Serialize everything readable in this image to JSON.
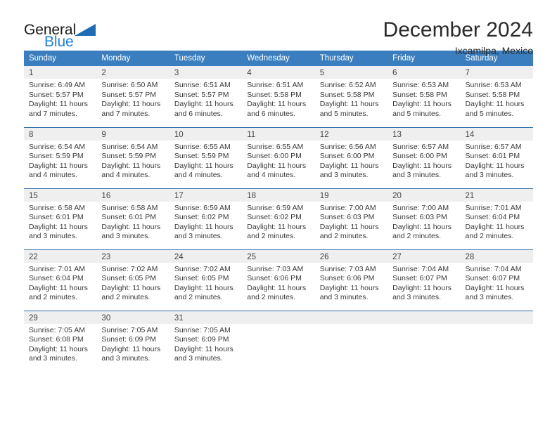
{
  "brand": {
    "line1": "General",
    "line2": "Blue",
    "logo_icon": "blue-triangle-icon",
    "accent_color": "#1f7fd4"
  },
  "header": {
    "title": "December 2024",
    "subtitle": "Ixcamilpa, Mexico"
  },
  "theme": {
    "header_bg": "#3a7ebf",
    "row_divider": "#2f6fae",
    "daynum_bg": "#efefef",
    "text": "#3a3a3a"
  },
  "weekdays": [
    "Sunday",
    "Monday",
    "Tuesday",
    "Wednesday",
    "Thursday",
    "Friday",
    "Saturday"
  ],
  "weeks": [
    [
      {
        "day": "1",
        "sunrise": "Sunrise: 6:49 AM",
        "sunset": "Sunset: 5:57 PM",
        "daylight1": "Daylight: 11 hours",
        "daylight2": "and 7 minutes."
      },
      {
        "day": "2",
        "sunrise": "Sunrise: 6:50 AM",
        "sunset": "Sunset: 5:57 PM",
        "daylight1": "Daylight: 11 hours",
        "daylight2": "and 7 minutes."
      },
      {
        "day": "3",
        "sunrise": "Sunrise: 6:51 AM",
        "sunset": "Sunset: 5:57 PM",
        "daylight1": "Daylight: 11 hours",
        "daylight2": "and 6 minutes."
      },
      {
        "day": "4",
        "sunrise": "Sunrise: 6:51 AM",
        "sunset": "Sunset: 5:58 PM",
        "daylight1": "Daylight: 11 hours",
        "daylight2": "and 6 minutes."
      },
      {
        "day": "5",
        "sunrise": "Sunrise: 6:52 AM",
        "sunset": "Sunset: 5:58 PM",
        "daylight1": "Daylight: 11 hours",
        "daylight2": "and 5 minutes."
      },
      {
        "day": "6",
        "sunrise": "Sunrise: 6:53 AM",
        "sunset": "Sunset: 5:58 PM",
        "daylight1": "Daylight: 11 hours",
        "daylight2": "and 5 minutes."
      },
      {
        "day": "7",
        "sunrise": "Sunrise: 6:53 AM",
        "sunset": "Sunset: 5:58 PM",
        "daylight1": "Daylight: 11 hours",
        "daylight2": "and 5 minutes."
      }
    ],
    [
      {
        "day": "8",
        "sunrise": "Sunrise: 6:54 AM",
        "sunset": "Sunset: 5:59 PM",
        "daylight1": "Daylight: 11 hours",
        "daylight2": "and 4 minutes."
      },
      {
        "day": "9",
        "sunrise": "Sunrise: 6:54 AM",
        "sunset": "Sunset: 5:59 PM",
        "daylight1": "Daylight: 11 hours",
        "daylight2": "and 4 minutes."
      },
      {
        "day": "10",
        "sunrise": "Sunrise: 6:55 AM",
        "sunset": "Sunset: 5:59 PM",
        "daylight1": "Daylight: 11 hours",
        "daylight2": "and 4 minutes."
      },
      {
        "day": "11",
        "sunrise": "Sunrise: 6:55 AM",
        "sunset": "Sunset: 6:00 PM",
        "daylight1": "Daylight: 11 hours",
        "daylight2": "and 4 minutes."
      },
      {
        "day": "12",
        "sunrise": "Sunrise: 6:56 AM",
        "sunset": "Sunset: 6:00 PM",
        "daylight1": "Daylight: 11 hours",
        "daylight2": "and 3 minutes."
      },
      {
        "day": "13",
        "sunrise": "Sunrise: 6:57 AM",
        "sunset": "Sunset: 6:00 PM",
        "daylight1": "Daylight: 11 hours",
        "daylight2": "and 3 minutes."
      },
      {
        "day": "14",
        "sunrise": "Sunrise: 6:57 AM",
        "sunset": "Sunset: 6:01 PM",
        "daylight1": "Daylight: 11 hours",
        "daylight2": "and 3 minutes."
      }
    ],
    [
      {
        "day": "15",
        "sunrise": "Sunrise: 6:58 AM",
        "sunset": "Sunset: 6:01 PM",
        "daylight1": "Daylight: 11 hours",
        "daylight2": "and 3 minutes."
      },
      {
        "day": "16",
        "sunrise": "Sunrise: 6:58 AM",
        "sunset": "Sunset: 6:01 PM",
        "daylight1": "Daylight: 11 hours",
        "daylight2": "and 3 minutes."
      },
      {
        "day": "17",
        "sunrise": "Sunrise: 6:59 AM",
        "sunset": "Sunset: 6:02 PM",
        "daylight1": "Daylight: 11 hours",
        "daylight2": "and 3 minutes."
      },
      {
        "day": "18",
        "sunrise": "Sunrise: 6:59 AM",
        "sunset": "Sunset: 6:02 PM",
        "daylight1": "Daylight: 11 hours",
        "daylight2": "and 2 minutes."
      },
      {
        "day": "19",
        "sunrise": "Sunrise: 7:00 AM",
        "sunset": "Sunset: 6:03 PM",
        "daylight1": "Daylight: 11 hours",
        "daylight2": "and 2 minutes."
      },
      {
        "day": "20",
        "sunrise": "Sunrise: 7:00 AM",
        "sunset": "Sunset: 6:03 PM",
        "daylight1": "Daylight: 11 hours",
        "daylight2": "and 2 minutes."
      },
      {
        "day": "21",
        "sunrise": "Sunrise: 7:01 AM",
        "sunset": "Sunset: 6:04 PM",
        "daylight1": "Daylight: 11 hours",
        "daylight2": "and 2 minutes."
      }
    ],
    [
      {
        "day": "22",
        "sunrise": "Sunrise: 7:01 AM",
        "sunset": "Sunset: 6:04 PM",
        "daylight1": "Daylight: 11 hours",
        "daylight2": "and 2 minutes."
      },
      {
        "day": "23",
        "sunrise": "Sunrise: 7:02 AM",
        "sunset": "Sunset: 6:05 PM",
        "daylight1": "Daylight: 11 hours",
        "daylight2": "and 2 minutes."
      },
      {
        "day": "24",
        "sunrise": "Sunrise: 7:02 AM",
        "sunset": "Sunset: 6:05 PM",
        "daylight1": "Daylight: 11 hours",
        "daylight2": "and 2 minutes."
      },
      {
        "day": "25",
        "sunrise": "Sunrise: 7:03 AM",
        "sunset": "Sunset: 6:06 PM",
        "daylight1": "Daylight: 11 hours",
        "daylight2": "and 2 minutes."
      },
      {
        "day": "26",
        "sunrise": "Sunrise: 7:03 AM",
        "sunset": "Sunset: 6:06 PM",
        "daylight1": "Daylight: 11 hours",
        "daylight2": "and 3 minutes."
      },
      {
        "day": "27",
        "sunrise": "Sunrise: 7:04 AM",
        "sunset": "Sunset: 6:07 PM",
        "daylight1": "Daylight: 11 hours",
        "daylight2": "and 3 minutes."
      },
      {
        "day": "28",
        "sunrise": "Sunrise: 7:04 AM",
        "sunset": "Sunset: 6:07 PM",
        "daylight1": "Daylight: 11 hours",
        "daylight2": "and 3 minutes."
      }
    ],
    [
      {
        "day": "29",
        "sunrise": "Sunrise: 7:05 AM",
        "sunset": "Sunset: 6:08 PM",
        "daylight1": "Daylight: 11 hours",
        "daylight2": "and 3 minutes."
      },
      {
        "day": "30",
        "sunrise": "Sunrise: 7:05 AM",
        "sunset": "Sunset: 6:09 PM",
        "daylight1": "Daylight: 11 hours",
        "daylight2": "and 3 minutes."
      },
      {
        "day": "31",
        "sunrise": "Sunrise: 7:05 AM",
        "sunset": "Sunset: 6:09 PM",
        "daylight1": "Daylight: 11 hours",
        "daylight2": "and 3 minutes."
      },
      {
        "day": "",
        "sunrise": "",
        "sunset": "",
        "daylight1": "",
        "daylight2": ""
      },
      {
        "day": "",
        "sunrise": "",
        "sunset": "",
        "daylight1": "",
        "daylight2": ""
      },
      {
        "day": "",
        "sunrise": "",
        "sunset": "",
        "daylight1": "",
        "daylight2": ""
      },
      {
        "day": "",
        "sunrise": "",
        "sunset": "",
        "daylight1": "",
        "daylight2": ""
      }
    ]
  ]
}
